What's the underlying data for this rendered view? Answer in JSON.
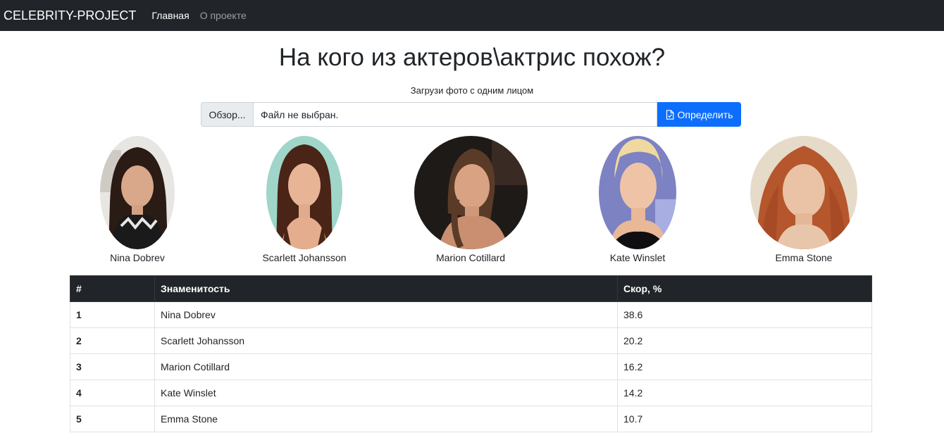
{
  "navbar": {
    "brand": "CELEBRITY-PROJECT",
    "links": [
      {
        "label": "Главная",
        "active": true
      },
      {
        "label": "О проекте",
        "active": false
      }
    ]
  },
  "header": {
    "title": "На кого из актеров\\актрис похож?",
    "subtitle": "Загрузи фото с одним лицом"
  },
  "upload": {
    "browse_label": "Обзор...",
    "file_status": "Файл не выбран.",
    "submit_label": "Определить",
    "submit_icon": "file-check-icon"
  },
  "celebrities": [
    {
      "name": "Nina Dobrev"
    },
    {
      "name": "Scarlett Johansson"
    },
    {
      "name": "Marion Cotillard"
    },
    {
      "name": "Kate Winslet"
    },
    {
      "name": "Emma Stone"
    }
  ],
  "table": {
    "headers": [
      "#",
      "Знаменитость",
      "Скор, %"
    ],
    "rows": [
      {
        "rank": "1",
        "name": "Nina Dobrev",
        "score": "38.6"
      },
      {
        "rank": "2",
        "name": "Scarlett Johansson",
        "score": "20.2"
      },
      {
        "rank": "3",
        "name": "Marion Cotillard",
        "score": "16.2"
      },
      {
        "rank": "4",
        "name": "Kate Winslet",
        "score": "14.2"
      },
      {
        "rank": "5",
        "name": "Emma Stone",
        "score": "10.7"
      }
    ]
  },
  "colors": {
    "navbar_bg": "#212529",
    "primary": "#0d6efd",
    "table_head_bg": "#212529"
  }
}
